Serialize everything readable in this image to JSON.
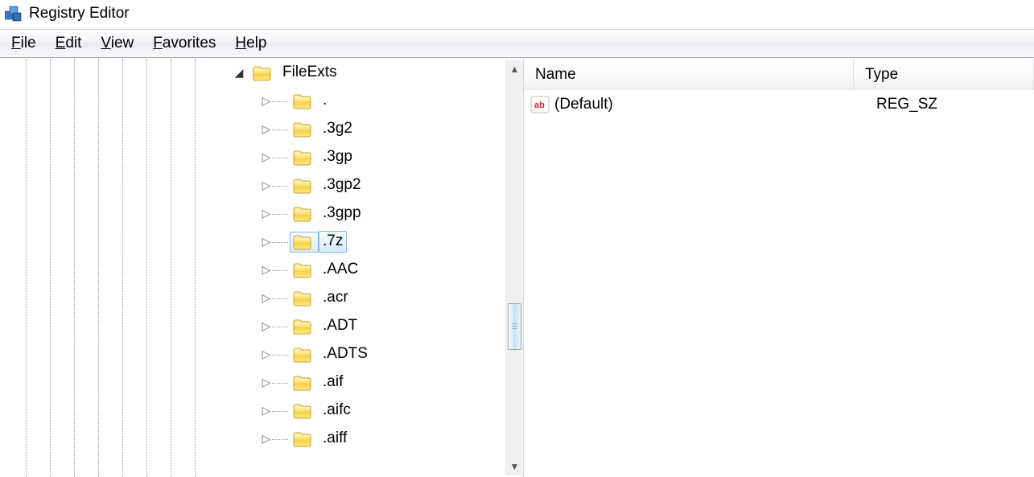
{
  "title": "Registry Editor",
  "menu": {
    "file": "File",
    "edit": "Edit",
    "view": "View",
    "favorites": "Favorites",
    "help": "Help"
  },
  "tree": {
    "ancestor_depth": 8,
    "root": {
      "label": "FileExts",
      "expanded": true
    },
    "children": [
      {
        "label": ".",
        "selected": false
      },
      {
        "label": ".3g2",
        "selected": false
      },
      {
        "label": ".3gp",
        "selected": false
      },
      {
        "label": ".3gp2",
        "selected": false
      },
      {
        "label": ".3gpp",
        "selected": false
      },
      {
        "label": ".7z",
        "selected": true
      },
      {
        "label": ".AAC",
        "selected": false
      },
      {
        "label": ".acr",
        "selected": false
      },
      {
        "label": ".ADT",
        "selected": false
      },
      {
        "label": ".ADTS",
        "selected": false
      },
      {
        "label": ".aif",
        "selected": false
      },
      {
        "label": ".aifc",
        "selected": false
      },
      {
        "label": ".aiff",
        "selected": false
      }
    ]
  },
  "list": {
    "columns": {
      "name": "Name",
      "type": "Type"
    },
    "rows": [
      {
        "name": "(Default)",
        "type": "REG_SZ"
      }
    ]
  }
}
